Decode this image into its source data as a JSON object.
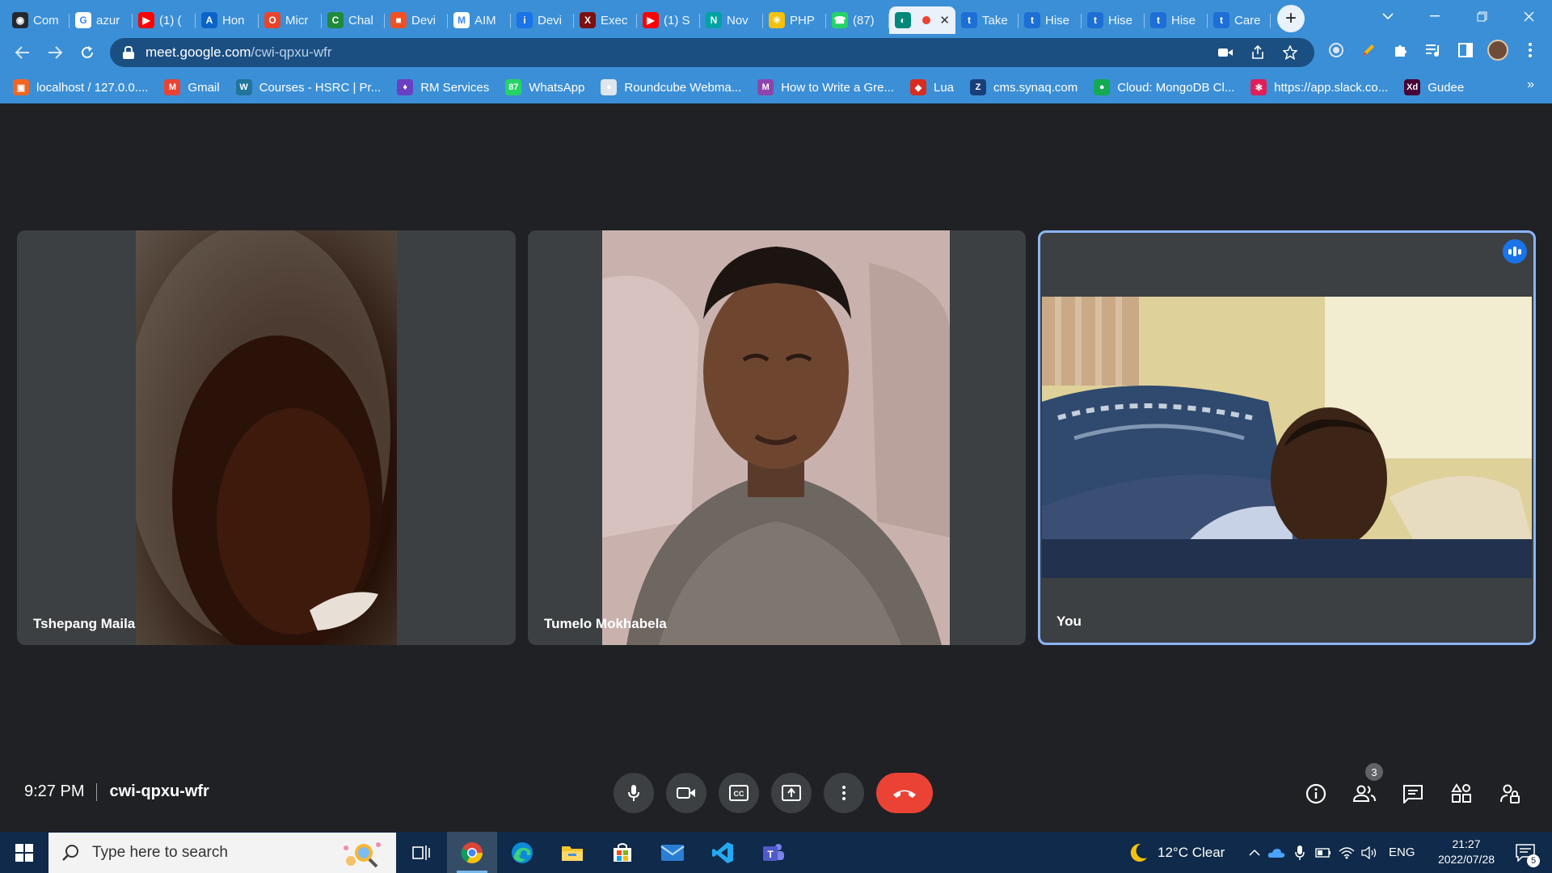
{
  "browser": {
    "tabs": [
      {
        "label": "Com",
        "icon": "github-icon",
        "color": "#24292f",
        "glyph": "◉"
      },
      {
        "label": "azur",
        "icon": "google-icon",
        "color": "#ffffff",
        "glyph": "G"
      },
      {
        "label": "(1) (",
        "icon": "youtube-icon",
        "color": "#ff0000",
        "glyph": "▶"
      },
      {
        "label": "Hon",
        "icon": "azure-icon",
        "color": "#0a64c8",
        "glyph": "A"
      },
      {
        "label": "Micr",
        "icon": "office-icon",
        "color": "#e8452c",
        "glyph": "O"
      },
      {
        "label": "Chal",
        "icon": "chat-icon",
        "color": "#1f8a3a",
        "glyph": "C"
      },
      {
        "label": "Devi",
        "icon": "microsoft-icon",
        "color": "#f25022",
        "glyph": "■"
      },
      {
        "label": "AIM",
        "icon": "gmail-icon",
        "color": "#ffffff",
        "glyph": "M"
      },
      {
        "label": "Devi",
        "icon": "info-icon",
        "color": "#1a73e8",
        "glyph": "i"
      },
      {
        "label": "Exec",
        "icon": "excel-icon",
        "color": "#7b1010",
        "glyph": "X"
      },
      {
        "label": "(1) S",
        "icon": "youtube-icon",
        "color": "#ff0000",
        "glyph": "▶"
      },
      {
        "label": "Nov",
        "icon": "n-icon",
        "color": "#00a3a3",
        "glyph": "N"
      },
      {
        "label": "PHP",
        "icon": "lightbulb-icon",
        "color": "#f4c20d",
        "glyph": "☀"
      },
      {
        "label": "(87)",
        "icon": "whatsapp-icon",
        "color": "#25d366",
        "glyph": "☎"
      },
      {
        "label": "",
        "icon": "meet-icon",
        "color": "#00897b",
        "glyph": "◐",
        "active": true
      },
      {
        "label": "Take",
        "icon": "tumblr-icon",
        "color": "#1d6fd6",
        "glyph": "t"
      },
      {
        "label": "Hise",
        "icon": "tumblr-icon",
        "color": "#1d6fd6",
        "glyph": "t"
      },
      {
        "label": "Hise",
        "icon": "tumblr-icon",
        "color": "#1d6fd6",
        "glyph": "t"
      },
      {
        "label": "Hise",
        "icon": "tumblr-icon",
        "color": "#1d6fd6",
        "glyph": "t"
      },
      {
        "label": "Care",
        "icon": "tumblr-icon",
        "color": "#1d6fd6",
        "glyph": "t"
      }
    ],
    "active_tab_close": "✕",
    "new_tab": "+",
    "url_host": "meet.google.com",
    "url_path": "/cwi-qpxu-wfr",
    "bookmarks": [
      {
        "label": "localhost / 127.0.0....",
        "icon": "phpmyadmin-icon",
        "color": "#f26522",
        "glyph": "▣"
      },
      {
        "label": "Gmail",
        "icon": "gmail-icon",
        "color": "#ea4335",
        "glyph": "M"
      },
      {
        "label": "Courses - HSRC | Pr...",
        "icon": "wordpress-icon",
        "color": "#21759b",
        "glyph": "W"
      },
      {
        "label": "RM Services",
        "icon": "shield-icon",
        "color": "#6a3fc1",
        "glyph": "♦"
      },
      {
        "label": "WhatsApp",
        "icon": "whatsapp-icon",
        "color": "#25d366",
        "glyph": "87"
      },
      {
        "label": "Roundcube Webma...",
        "icon": "roundcube-icon",
        "color": "#dfe6ee",
        "glyph": "●"
      },
      {
        "label": "How to Write a Gre...",
        "icon": "m-icon",
        "color": "#8e44ad",
        "glyph": "M"
      },
      {
        "label": "Lua",
        "icon": "redis-icon",
        "color": "#d82c20",
        "glyph": "◆"
      },
      {
        "label": "cms.synaq.com",
        "icon": "z-icon",
        "color": "#1a3e7a",
        "glyph": "Z"
      },
      {
        "label": "Cloud: MongoDB Cl...",
        "icon": "mongodb-icon",
        "color": "#13aa52",
        "glyph": "●"
      },
      {
        "label": "https://app.slack.co...",
        "icon": "slack-icon",
        "color": "#e01e5a",
        "glyph": "✻"
      },
      {
        "label": "Gudee",
        "icon": "xd-icon",
        "color": "#470137",
        "glyph": "Xd"
      }
    ],
    "bookmarks_more": "»"
  },
  "meet": {
    "participants": [
      {
        "name": "Tshepang Maila"
      },
      {
        "name": "Tumelo Mokhabela"
      },
      {
        "name": "You"
      }
    ],
    "time": "9:27 PM",
    "meeting_code": "cwi-qpxu-wfr",
    "people_count": "3"
  },
  "taskbar": {
    "search_placeholder": "Type here to search",
    "weather": "12°C  Clear",
    "language": "ENG",
    "time": "21:27",
    "date": "2022/07/28",
    "notification_count": "5"
  }
}
